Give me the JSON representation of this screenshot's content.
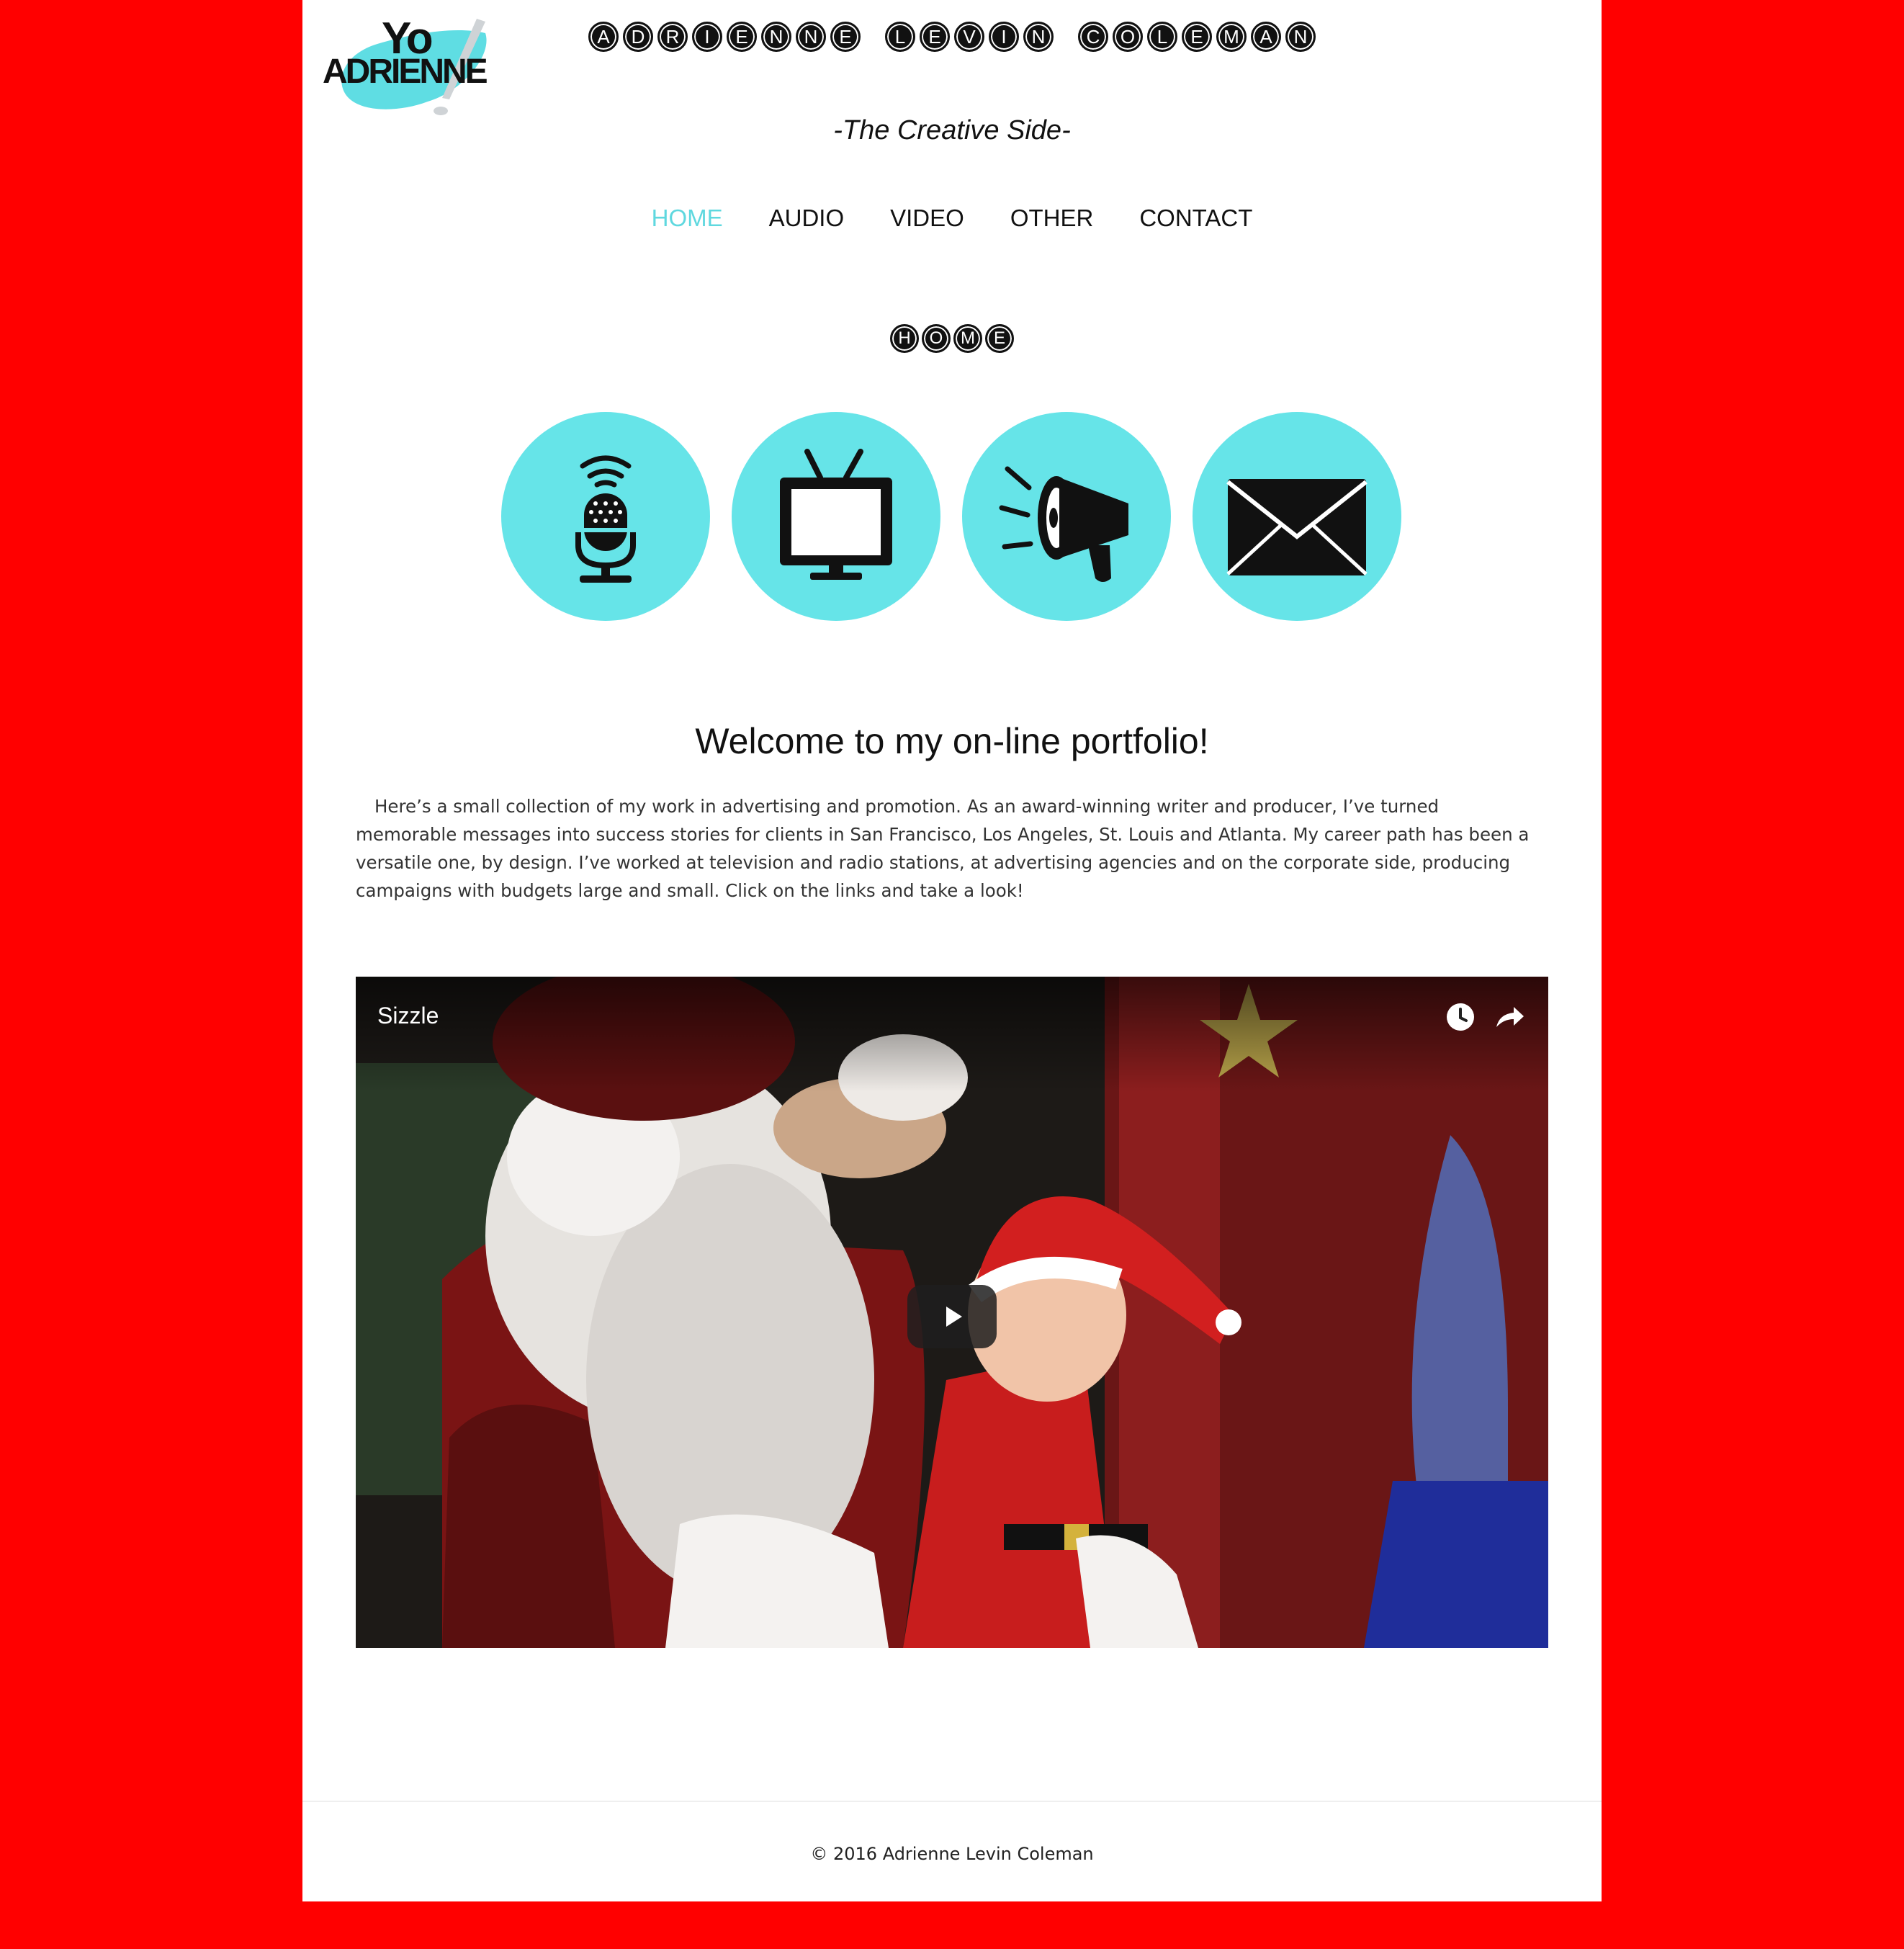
{
  "logo": {
    "line1": "Yo",
    "line2": "ADRIENNE"
  },
  "site": {
    "title_words": [
      "ADRIENNE",
      "LEVIN",
      "COLEMAN"
    ],
    "tagline": "-The Creative Side-"
  },
  "nav": {
    "items": [
      {
        "label": "HOME",
        "active": true
      },
      {
        "label": "AUDIO",
        "active": false
      },
      {
        "label": "VIDEO",
        "active": false
      },
      {
        "label": "OTHER",
        "active": false
      },
      {
        "label": "CONTACT",
        "active": false
      }
    ]
  },
  "section": {
    "title": "HOME"
  },
  "icons": [
    {
      "name": "microphone-icon"
    },
    {
      "name": "television-icon"
    },
    {
      "name": "megaphone-icon"
    },
    {
      "name": "envelope-icon"
    }
  ],
  "main": {
    "heading": "Welcome to my on-line portfolio!",
    "intro": "Here’s a small collection of my work in advertising and promotion. As an award-winning writer and producer, I’ve turned memorable messages into success stories for clients in San Francisco, Los Angeles, St. Louis and Atlanta. My career path has been a versatile one, by design. I’ve worked at television and radio stations, at advertising agencies and on the corporate side, producing campaigns with budgets large and small. Click on the links and take a look!"
  },
  "video": {
    "title": "Sizzle"
  },
  "footer": {
    "copyright": "© 2016 Adrienne Levin Coleman"
  },
  "colors": {
    "accent": "#66e4e8",
    "nav_active": "#5fd8df",
    "background": "#ff0000"
  }
}
